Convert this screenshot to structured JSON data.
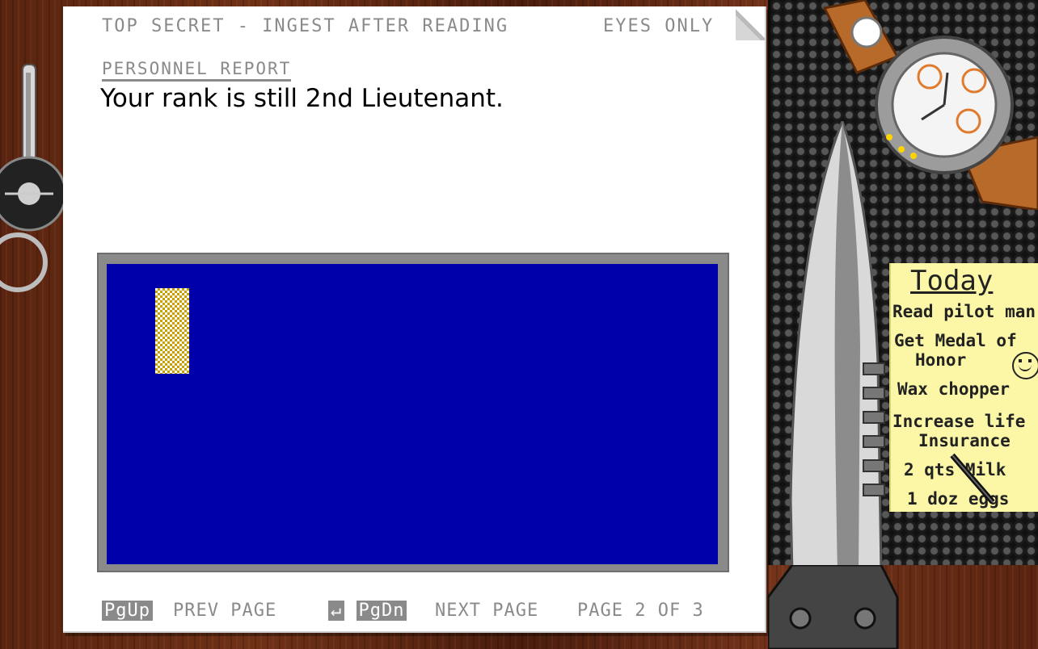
{
  "document": {
    "header_left": "TOP SECRET - INGEST AFTER READING",
    "header_right": "EYES ONLY",
    "report_label": "PERSONNEL REPORT",
    "message": "Your rank is still 2nd Lieutenant."
  },
  "footer": {
    "pgup_key": "PgUp",
    "prev_label": "PREV PAGE",
    "next_key": "↵",
    "pgdn_key": "PgDn",
    "next_label": "NEXT PAGE",
    "page_indicator": "PAGE 2 OF 3"
  },
  "note": {
    "title": "Today",
    "items": [
      "Read pilot man",
      "Get Medal of",
      "Honor",
      "Wax chopper",
      "Increase life",
      "Insurance",
      "2 qts Milk",
      "1 doz eggs"
    ]
  },
  "colors": {
    "viewport_blue": "#0000aa",
    "paper": "#ffffff",
    "text_gray": "#8a8a8a",
    "note_yellow": "#fbf7a6",
    "wood": "#5a2410"
  },
  "icons": [
    "key-ring-icon",
    "wrist-watch-icon",
    "combat-knife-icon",
    "smiley-icon",
    "pen-icon",
    "rank-insignia-icon"
  ]
}
